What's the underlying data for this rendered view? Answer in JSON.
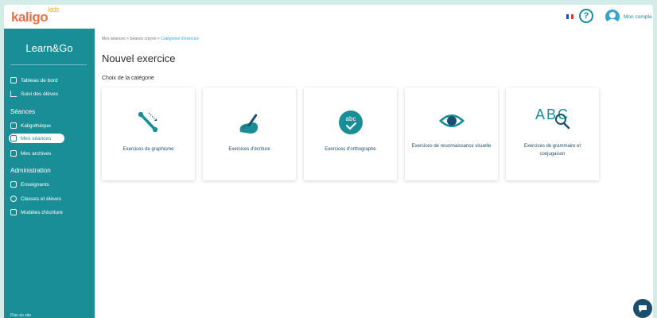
{
  "header": {
    "logo_text": "kaligo",
    "logo_sup": "kids",
    "help_label": "?",
    "account_label": "Mon compte"
  },
  "sidebar": {
    "brand": "Learn&Go",
    "items_top": [
      {
        "label": "Tableau de bord",
        "icon": "dashboard-icon"
      },
      {
        "label": "Suivi des élèves",
        "icon": "chart-line-icon"
      }
    ],
    "section_seances": "Séances",
    "items_seances": [
      {
        "label": "Kaligothèque",
        "icon": "library-icon"
      },
      {
        "label": "Mes séances",
        "icon": "sessions-icon",
        "active": true
      },
      {
        "label": "Mes archives",
        "icon": "archive-icon"
      }
    ],
    "section_admin": "Administration",
    "items_admin": [
      {
        "label": "Enseignants",
        "icon": "id-card-icon"
      },
      {
        "label": "Classes et élèves",
        "icon": "users-icon"
      },
      {
        "label": "Modèles d'écriture",
        "icon": "templates-icon"
      }
    ],
    "footer": "Plan du site"
  },
  "main": {
    "breadcrumb": [
      "Mes séances",
      "Séance crayon",
      "Catégories d'exercice"
    ],
    "breadcrumb_sep": " > ",
    "title": "Nouvel exercice",
    "subtitle": "Choix de la catégorie",
    "cards": [
      {
        "label": "Exercices de graphisme",
        "icon": "graphism-icon"
      },
      {
        "label": "Exercices d'écriture",
        "icon": "writing-icon"
      },
      {
        "label": "Exercices d'orthographe",
        "icon": "spelling-icon",
        "icon_text": "abc"
      },
      {
        "label": "Exercices de reconnaissance visuelle",
        "icon": "eye-icon"
      },
      {
        "label": "Exercices de grammaire et conjugaison",
        "icon": "grammar-icon",
        "icon_text": "ABC"
      }
    ]
  },
  "colors": {
    "teal": "#1a8e96",
    "navy": "#1b4e6e",
    "orange": "#e9704a",
    "background": "#d4ece8"
  }
}
